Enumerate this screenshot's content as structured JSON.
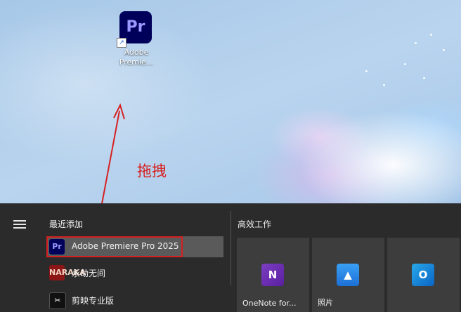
{
  "desktop": {
    "premiere_shortcut": {
      "icon_text": "Pr",
      "label": "Adobe\nPremie..."
    }
  },
  "annotation": {
    "label": "拖拽",
    "color": "#d62020"
  },
  "start_menu": {
    "recent_heading": "最近添加",
    "recent_apps": [
      {
        "name": "Adobe Premiere Pro 2025",
        "icon": "Pr",
        "icon_name": "premiere-pro-icon"
      },
      {
        "name": "永劫无间",
        "icon": "NARAKA",
        "icon_name": "naraka-icon"
      },
      {
        "name": "剪映专业版",
        "icon": "✂",
        "icon_name": "jianying-icon"
      }
    ],
    "productivity_heading": "高效工作",
    "tiles": [
      {
        "label": "OneNote for...",
        "icon": "N",
        "icon_name": "onenote-icon"
      },
      {
        "label": "照片",
        "icon": "▲",
        "icon_name": "photos-icon"
      },
      {
        "label": "",
        "icon": "O",
        "icon_name": "outlook-icon"
      }
    ]
  }
}
